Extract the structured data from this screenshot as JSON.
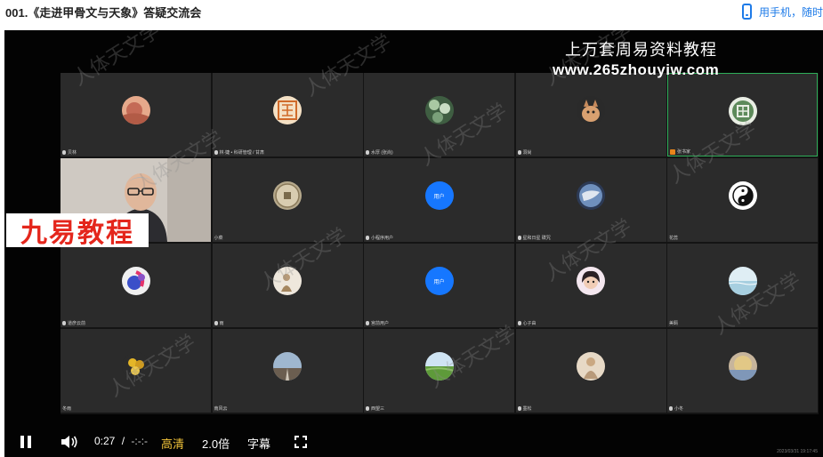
{
  "page": {
    "title": "001.《走进甲骨文与天象》答疑交流会",
    "mobile_link": "用手机，随时"
  },
  "video": {
    "overlay_title": "上万套周易资料教程",
    "overlay_url": "www.265zhouyiw.com",
    "brand_stamp": "九易教程",
    "watermark_text": "人体天文学",
    "stamp_time": "2023/03/31 19:17:45",
    "participants": [
      {
        "name": "贝林",
        "avatar": "sunset",
        "mic": "normal"
      },
      {
        "name": "林·婕 • 科研管理 / 甘肃",
        "avatar": "seal",
        "mic": "normal"
      },
      {
        "name": "水厚 (张尚)",
        "avatar": "leaves",
        "mic": "normal"
      },
      {
        "name": "洞尚",
        "avatar": "cat",
        "mic": "normal"
      },
      {
        "name": "张书家",
        "avatar": "plant",
        "mic": "orange"
      },
      {
        "name": "",
        "avatar": "camera",
        "mic": "none"
      },
      {
        "name": "小菜",
        "avatar": "coin",
        "mic": "none"
      },
      {
        "name": "小程序用户",
        "avatar": "blue",
        "mic": "normal"
      },
      {
        "name": "星和日星 碟咒",
        "avatar": "earth",
        "mic": "normal"
      },
      {
        "name": "花蕊",
        "avatar": "taiji",
        "mic": "none"
      },
      {
        "name": "道彦云前",
        "avatar": "violet",
        "mic": "normal"
      },
      {
        "name": "雨",
        "avatar": "figure",
        "mic": "normal"
      },
      {
        "name": "宫前用户",
        "avatar": "blue",
        "mic": "normal"
      },
      {
        "name": "心子由",
        "avatar": "girl",
        "mic": "normal"
      },
      {
        "name": "美羁",
        "avatar": "sea",
        "mic": "none"
      },
      {
        "name": "冬雨",
        "avatar": "flower",
        "mic": "none"
      },
      {
        "name": "南风云",
        "avatar": "road",
        "mic": "none"
      },
      {
        "name": "西望三",
        "avatar": "field",
        "mic": "normal"
      },
      {
        "name": "墨松",
        "avatar": "person",
        "mic": "normal"
      },
      {
        "name": "小冬",
        "avatar": "lake",
        "mic": "normal"
      }
    ],
    "blue_avatar_text": "用户"
  },
  "controls": {
    "current_time": "0:27",
    "separator": "/",
    "duration": "-:-:-",
    "quality_label": "高清",
    "speed_label": "2.0倍",
    "subtitle_label": "字幕"
  },
  "colors": {
    "accent": "#1e7be8",
    "quality": "#f3c43a",
    "active_border": "#2eae58",
    "blue_avatar": "#1677ff",
    "brand_red": "#e4261c"
  }
}
